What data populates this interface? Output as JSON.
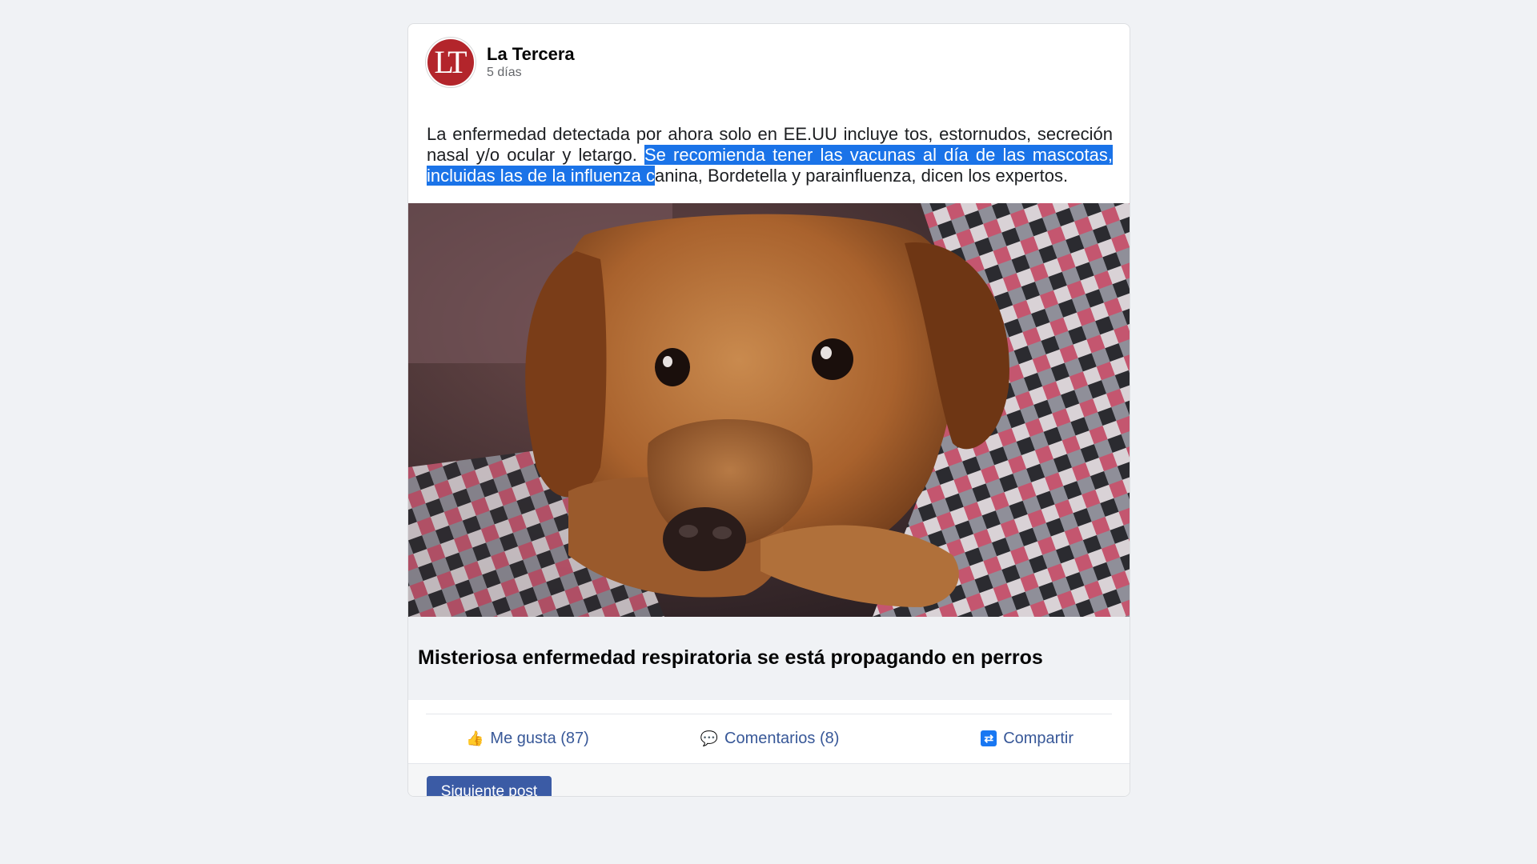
{
  "post": {
    "page_name": "La Tercera",
    "avatar_initials": "LT",
    "time": "5 días",
    "text_before": "La enfermedad detectada por ahora solo en EE.UU incluye tos, estornudos, secreción nasal y/o ocular y letargo. ",
    "text_highlight": "Se recomienda tener las vacunas al día de las mascotas, incluidas las de la influenza c",
    "text_after": "anina, Bordetella y parainfluenza, dicen los expertos.",
    "image_alt": "Perro",
    "link_title": "Misteriosa enfermedad respiratoria se está propagando en perros"
  },
  "actions": {
    "like_label": "Me gusta (87)",
    "comment_label": "Comentarios (8)",
    "share_label": "Compartir"
  },
  "next_button_label": "Siguiente post",
  "colors": {
    "avatar_bg": "#b3252b",
    "action_text": "#385898",
    "button_bg": "#3b5ba5",
    "highlight": "#1a73e8"
  },
  "icons": {
    "like": "thumbs-up-icon",
    "comment": "speech-bubble-icon",
    "share": "share-icon"
  }
}
